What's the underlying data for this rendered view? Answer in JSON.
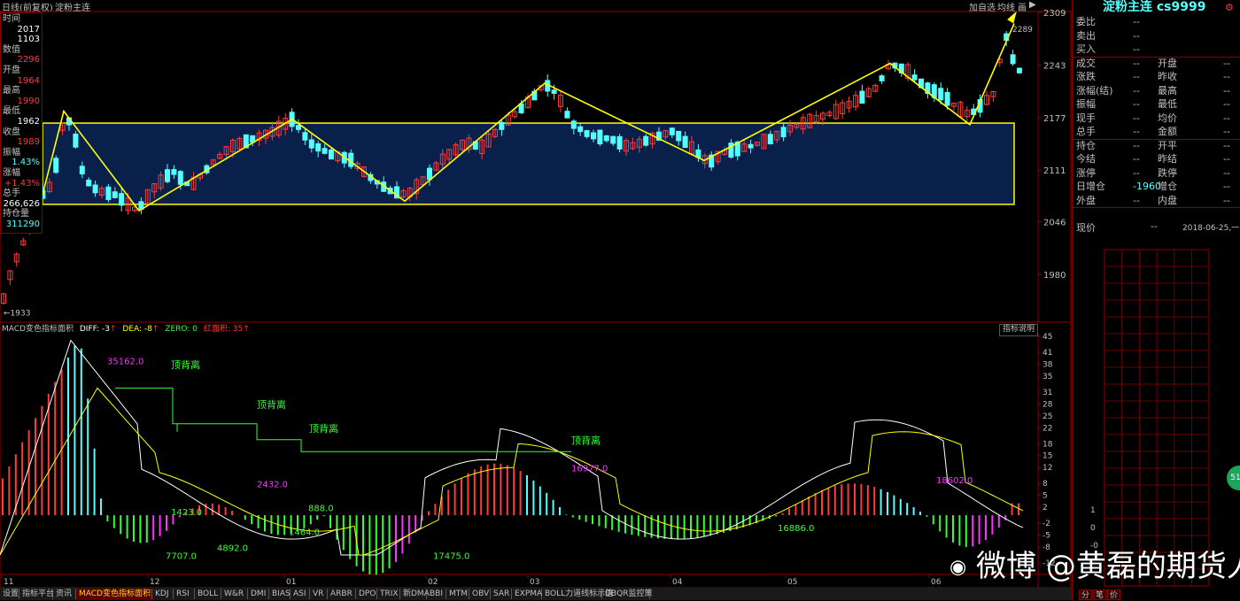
{
  "topbar": {
    "period_label": "日线(前复权)",
    "symbol_name": "淀粉主连",
    "add_watch_label": "加自选",
    "ma_label": "均线",
    "canvas_label": "画",
    "right_arrow": "▶"
  },
  "info_box": {
    "labels": [
      "时间",
      "2017",
      "1103",
      "数值",
      "2296",
      "开盘",
      "1964",
      "最高",
      "1990",
      "最低",
      "1962",
      "收盘",
      "1989",
      "振幅",
      "1.43%",
      "涨幅",
      "+1.43%",
      "总手",
      "266,626",
      "持仓量",
      "311290"
    ]
  },
  "price_axis": {
    "ticks": [
      "2309",
      "2243",
      "2177",
      "2111",
      "2046",
      "1980"
    ],
    "high_marker": "2289",
    "low_marker": "1933"
  },
  "macd_header": {
    "name": "MACD变色指标面积",
    "diff": "DIFF: -3",
    "dea": "DEA: -8",
    "zero": "ZERO: 0",
    "red_area": "红面积: 35",
    "help_label": "指标说明"
  },
  "macd_axis": {
    "ticks": [
      "45",
      "41",
      "38",
      "35",
      "31",
      "28",
      "25",
      "22",
      "18",
      "15",
      "12",
      "8",
      "5",
      "2",
      "-2",
      "-5",
      "-8",
      "-12"
    ]
  },
  "macd_annotations": {
    "area_values": [
      "35162.0",
      "2432.0",
      "1464.0",
      "16977.0",
      "18602.0",
      "7707.0",
      "4892.0",
      "17475.0",
      "16886.0",
      "1423.0",
      "888.0"
    ],
    "divergence_label": "顶背离"
  },
  "date_axis": {
    "labels": [
      "11",
      "12",
      "01",
      "02",
      "03",
      "04",
      "05",
      "06"
    ]
  },
  "right_panel": {
    "title": "淀粉主连  cs9999",
    "rows_top": [
      {
        "label": "委比",
        "value": "--"
      },
      {
        "label": "卖出",
        "value": "--"
      },
      {
        "label": "买入",
        "value": "--"
      }
    ],
    "rows_mid": [
      {
        "label": "成交",
        "mid": "--",
        "label2": "开盘",
        "value2": "--"
      },
      {
        "label": "涨跌",
        "mid": "--",
        "label2": "昨收",
        "value2": "--"
      },
      {
        "label": "涨幅(结)",
        "mid": "--",
        "label2": "最高",
        "value2": "--"
      },
      {
        "label": "振幅",
        "mid": "--",
        "label2": "最低",
        "value2": "--"
      },
      {
        "label": "现手",
        "mid": "--",
        "label2": "均价",
        "value2": "--"
      },
      {
        "label": "总手",
        "mid": "--",
        "label2": "金额",
        "value2": "--"
      }
    ],
    "rows_low": [
      {
        "label": "持仓",
        "mid": "--",
        "label2": "开平",
        "value2": "--"
      },
      {
        "label": "今结",
        "mid": "--",
        "label2": "昨结",
        "value2": "--"
      },
      {
        "label": "涨停",
        "mid": "--",
        "label2": "跌停",
        "value2": "--"
      },
      {
        "label": "日增仓",
        "mid": "-1960",
        "label2": "增仓",
        "value2": "--"
      },
      {
        "label": "外盘",
        "mid": "--",
        "label2": "内盘",
        "value2": "--"
      }
    ],
    "price_label": "现价",
    "price_value": "--",
    "date_value": "2018-06-25,一",
    "mini_axis": [
      "1",
      "0",
      "-0"
    ],
    "side_badge": "51"
  },
  "bottom_tabs": [
    "设置",
    "指标平台",
    "资讯",
    "MACD变色指标面积",
    "KDJ",
    "RSI",
    "BOLL",
    "W&R",
    "DMI",
    "BIAS",
    "ASI",
    "VR",
    "ARBR",
    "DPO",
    "TRIX",
    "新DMA",
    "BBI",
    "MTM",
    "OBV",
    "SAR",
    "EXPMA",
    "BOLL力道线标示值",
    "DBQR监控策"
  ],
  "right_tabs": [
    "分",
    "笔",
    "价"
  ],
  "watermark": "微博 @黄磊的期货人生",
  "colors": {
    "up": "#ff3b3b",
    "down": "#54ffff",
    "trendline": "#ffff00",
    "channel_fill": "#08204a",
    "macd_neg": "#33ff33",
    "macd_magenta": "#ff33ff",
    "border": "#8a0000"
  }
}
